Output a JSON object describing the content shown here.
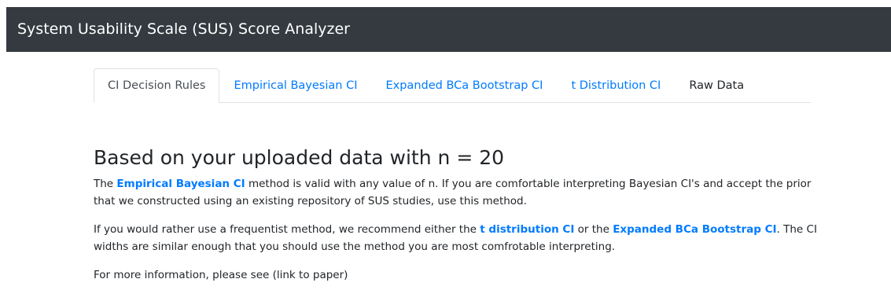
{
  "app": {
    "title": "System Usability Scale (SUS) Score Analyzer"
  },
  "tabs": [
    {
      "label": "CI Decision Rules",
      "active": true
    },
    {
      "label": "Empirical Bayesian CI",
      "active": false
    },
    {
      "label": "Expanded BCa Bootstrap CI",
      "active": false
    },
    {
      "label": "t Distribution CI",
      "active": false
    },
    {
      "label": "Raw Data",
      "active": false
    }
  ],
  "main": {
    "heading": "Based on your uploaded data with n = 20",
    "para1": {
      "before": "The ",
      "link": "Empirical Bayesian CI",
      "after": " method is valid with any value of n. If you are comfortable interpreting Bayesian CI's and accept the prior that we constructed using an existing repository of SUS studies, use this method."
    },
    "para2": {
      "before": "If you would rather use a frequentist method, we recommend either the ",
      "link1": "t distribution CI",
      "middle": " or the ",
      "link2": "Expanded BCa Bootstrap CI",
      "after": ". The CI widths are similar enough that you should use the method you are most comfrotable interpreting."
    },
    "para3": "For more information, please see (link to paper)"
  },
  "colors": {
    "navbar_bg": "#343a40",
    "link": "#007bff",
    "text": "#212529"
  }
}
